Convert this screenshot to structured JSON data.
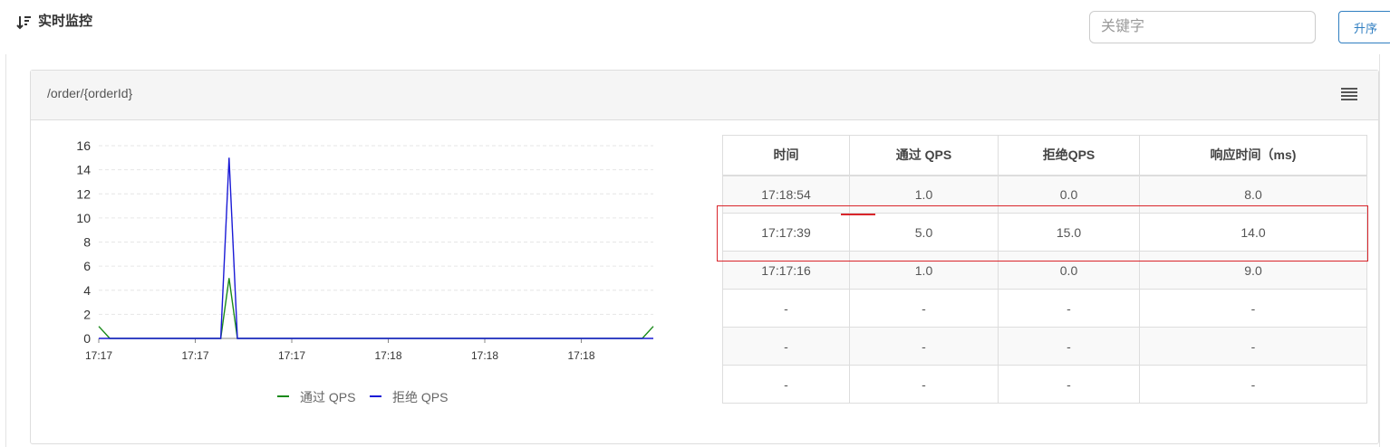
{
  "header": {
    "title": "实时监控",
    "search_placeholder": "关键字",
    "sort_label": "升序"
  },
  "panel": {
    "title": "/order/{orderId}"
  },
  "chart_data": {
    "type": "line",
    "x": [
      "17:17",
      "17:17",
      "17:17",
      "17:18",
      "17:18",
      "17:18"
    ],
    "ylim": [
      0,
      16
    ],
    "yticks": [
      0,
      2,
      4,
      6,
      8,
      10,
      12,
      14,
      16
    ],
    "series": [
      {
        "name": "通过 QPS",
        "color": "#1a8a1a",
        "points": [
          [
            0,
            1
          ],
          [
            0.02,
            0
          ],
          [
            0.22,
            0
          ],
          [
            0.235,
            5
          ],
          [
            0.25,
            0
          ],
          [
            0.98,
            0
          ],
          [
            1.0,
            1
          ]
        ]
      },
      {
        "name": "拒绝 QPS",
        "color": "#1a1ad6",
        "points": [
          [
            0,
            0
          ],
          [
            0.22,
            0
          ],
          [
            0.235,
            15
          ],
          [
            0.25,
            0
          ],
          [
            1.0,
            0
          ]
        ]
      }
    ],
    "grid": true,
    "legend": "bottom"
  },
  "table": {
    "headers": [
      "时间",
      "通过 QPS",
      "拒绝QPS",
      "响应时间（ms)"
    ],
    "rows": [
      [
        "17:18:54",
        "1.0",
        "0.0",
        "8.0"
      ],
      [
        "17:17:39",
        "5.0",
        "15.0",
        "14.0"
      ],
      [
        "17:17:16",
        "1.0",
        "0.0",
        "9.0"
      ],
      [
        "-",
        "-",
        "-",
        "-"
      ],
      [
        "-",
        "-",
        "-",
        "-"
      ],
      [
        "-",
        "-",
        "-",
        "-"
      ]
    ]
  },
  "colors": {
    "accent": "#2f7ec1",
    "highlight": "#d9252b"
  }
}
